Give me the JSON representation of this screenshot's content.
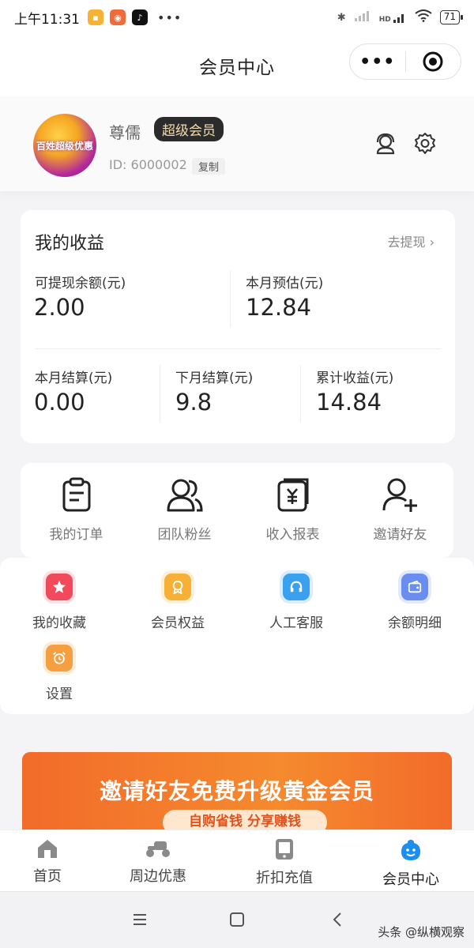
{
  "status_bar": {
    "time": "上午11:31",
    "battery": "71",
    "network": "HD"
  },
  "title_bar": {
    "title": "会员中心"
  },
  "profile": {
    "nickname": "尊儒",
    "badge": "超级会员",
    "user_id": "ID: 6000002",
    "copy_label": "复制",
    "avatar_text": "百姓超级优惠"
  },
  "earnings": {
    "title": "我的收益",
    "withdraw_link": "去提现",
    "stats": [
      {
        "label": "可提现余额(元)",
        "value": "2.00"
      },
      {
        "label": "本月预估(元)",
        "value": "12.84"
      },
      {
        "label": "本月结算(元)",
        "value": "0.00"
      },
      {
        "label": "下月结算(元)",
        "value": "9.8"
      },
      {
        "label": "累计收益(元)",
        "value": "14.84"
      }
    ]
  },
  "quick_actions": [
    {
      "label": "我的订单",
      "icon": "clipboard-icon"
    },
    {
      "label": "团队粉丝",
      "icon": "team-icon"
    },
    {
      "label": "收入报表",
      "icon": "yen-report-icon"
    },
    {
      "label": "邀请好友",
      "icon": "add-user-icon"
    }
  ],
  "services": [
    {
      "label": "我的收藏",
      "icon": "star-icon",
      "color": "#f04a5c"
    },
    {
      "label": "会员权益",
      "icon": "badge-icon",
      "color": "#f5b035"
    },
    {
      "label": "人工客服",
      "icon": "headset-icon",
      "color": "#3aa0f0"
    },
    {
      "label": "余额明细",
      "icon": "wallet-icon",
      "color": "#6a8ef0"
    },
    {
      "label": "设置",
      "icon": "alarm-clock-icon",
      "color": "#f5a040"
    }
  ],
  "banner": {
    "title": "邀请好友免费升级黄金会员",
    "subtitle": "自购省钱 分享赚钱"
  },
  "tab_bar": [
    {
      "label": "首页",
      "icon": "home-icon"
    },
    {
      "label": "周边优惠",
      "icon": "scooter-icon"
    },
    {
      "label": "折扣充值",
      "icon": "tablet-icon"
    },
    {
      "label": "会员中心",
      "icon": "member-face-icon"
    }
  ],
  "watermark": "头条 @纵横观察",
  "colors": {
    "accent": "#1a8ff0",
    "banner": "#f26b2a",
    "badge_bg": "#2b2b2b"
  }
}
